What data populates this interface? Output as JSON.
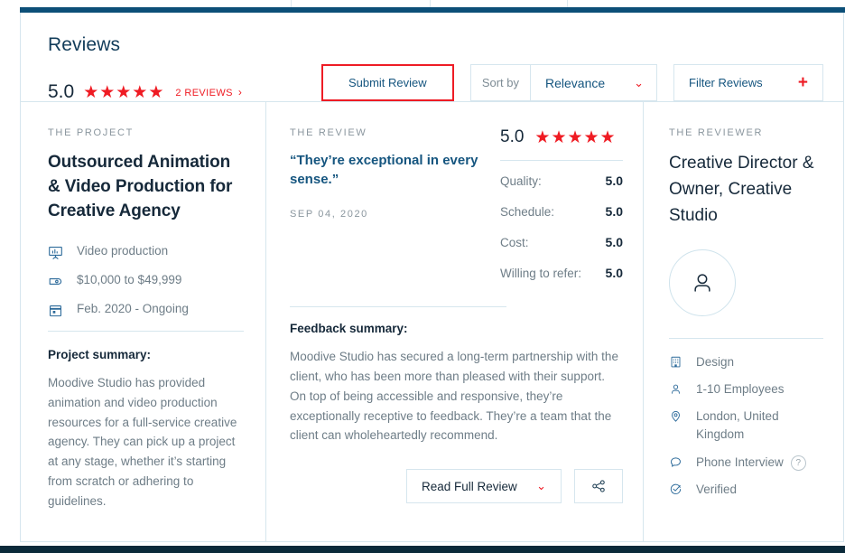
{
  "header": {
    "title": "Reviews",
    "rating": "5.0",
    "stars": "★★★★★",
    "reviews_link": "2 REVIEWS",
    "reviews_chevron": "›",
    "submit_label": "Submit Review",
    "sort_label": "Sort by",
    "sort_value": "Relevance",
    "sort_chevron": "⌄",
    "filter_label": "Filter Reviews",
    "filter_plus": "+"
  },
  "project": {
    "eyebrow": "THE PROJECT",
    "title": "Outsourced Animation & Video Production for Creative Agency",
    "meta": [
      {
        "icon": "video-production-icon",
        "label": "Video production"
      },
      {
        "icon": "price-tag-icon",
        "label": "$10,000 to $49,999"
      },
      {
        "icon": "calendar-icon",
        "label": "Feb. 2020 - Ongoing"
      }
    ],
    "summary_heading": "Project summary:",
    "summary_text": "Moodive Studio has provided animation and video production resources for a full-service creative agency. They can pick up a project at any stage, whether it’s starting from scratch or adhering to guidelines."
  },
  "review": {
    "eyebrow": "THE REVIEW",
    "quote": "“They’re exceptional in every sense.”",
    "date": "SEP 04, 2020",
    "overall_score": "5.0",
    "stars": "★★★★★",
    "scores": [
      {
        "label": "Quality:",
        "value": "5.0"
      },
      {
        "label": "Schedule:",
        "value": "5.0"
      },
      {
        "label": "Cost:",
        "value": "5.0"
      },
      {
        "label": "Willing to refer:",
        "value": "5.0"
      }
    ],
    "feedback_heading": "Feedback summary:",
    "feedback_text": "Moodive Studio has secured a long-term partnership with the client, who has been more than pleased with their support. On top of being accessible and responsive, they’re exceptionally receptive to feedback. They’re a team that the client can wholeheartedly recommend.",
    "read_full_label": "Read Full Review",
    "read_full_chevron": "⌄",
    "share_icon": "share-icon"
  },
  "reviewer": {
    "eyebrow": "THE REVIEWER",
    "name": "Creative Director & Owner, Creative Studio",
    "avatar_icon": "person-avatar-icon",
    "details": [
      {
        "icon": "building-icon",
        "label": "Design",
        "badge": ""
      },
      {
        "icon": "person-icon",
        "label": "1-10 Employees",
        "badge": ""
      },
      {
        "icon": "location-pin-icon",
        "label": "London, United Kingdom",
        "badge": ""
      },
      {
        "icon": "chat-bubble-icon",
        "label": "Phone Interview",
        "badge": "?"
      },
      {
        "icon": "verified-check-icon",
        "label": "Verified",
        "badge": ""
      }
    ]
  },
  "colors": {
    "accent_red": "#ee1c25",
    "brand_blue": "#15557f",
    "dark_navy": "#16293a",
    "border": "#d6e6ee",
    "topbar": "#0c4f78"
  }
}
